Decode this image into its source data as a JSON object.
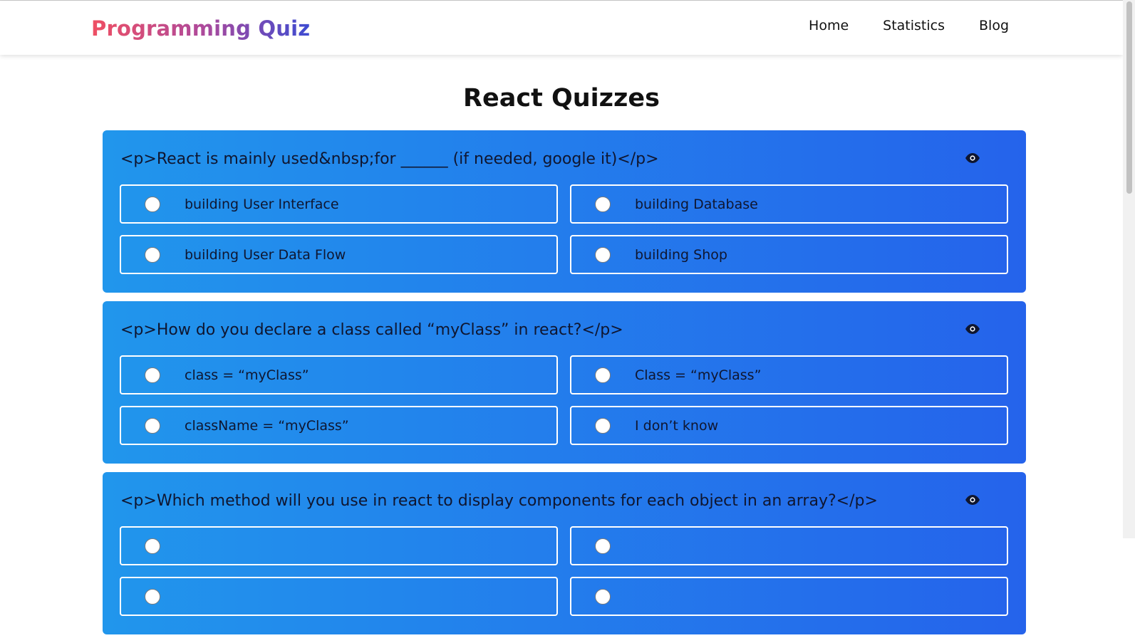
{
  "brand": {
    "text": "Programming Quiz",
    "gradient": [
      "#ef4f63",
      "#b04a9a",
      "#3d4bd1"
    ]
  },
  "nav": {
    "items": [
      {
        "label": "Home"
      },
      {
        "label": "Statistics"
      },
      {
        "label": "Blog"
      }
    ]
  },
  "page": {
    "title": "React Quizzes"
  },
  "theme": {
    "card_gradient_start": "#2196ec",
    "card_gradient_end": "#2563eb",
    "option_border": "#ffffff"
  },
  "questions": [
    {
      "text": "<p>React is mainly used&nbsp;for ______ (if needed, google it)</p>",
      "reveal_icon": "eye-icon",
      "options": [
        {
          "label": "building User Interface"
        },
        {
          "label": "building Database"
        },
        {
          "label": "building User Data Flow"
        },
        {
          "label": "building Shop"
        }
      ]
    },
    {
      "text": "<p>How do you declare a class called “myClass” in react?</p>",
      "reveal_icon": "eye-icon",
      "options": [
        {
          "label": "class = “myClass”"
        },
        {
          "label": "Class = “myClass”"
        },
        {
          "label": "className = “myClass”"
        },
        {
          "label": "I don’t know"
        }
      ]
    },
    {
      "text": "<p>Which method will you use in react to display components for each object in an array?</p>",
      "reveal_icon": "eye-icon",
      "options": [
        {
          "label": ""
        },
        {
          "label": ""
        },
        {
          "label": ""
        },
        {
          "label": ""
        }
      ]
    }
  ]
}
